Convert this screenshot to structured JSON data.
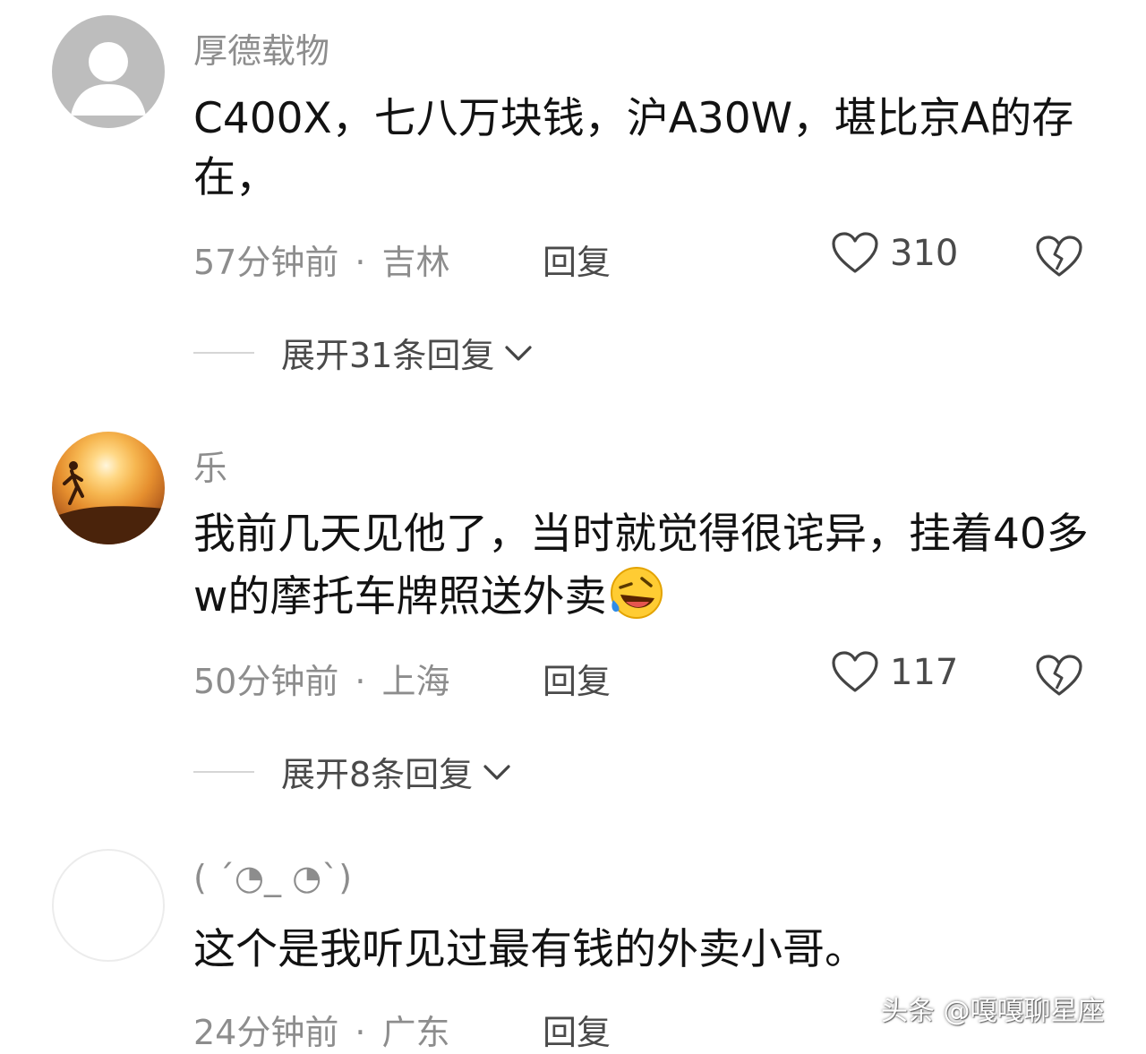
{
  "comments": [
    {
      "username": "厚德载物",
      "content": "C400X，七八万块钱，沪A30W，堪比京A的存在，",
      "time": "57分钟前",
      "location": "吉林",
      "reply_label": "回复",
      "likes": "310",
      "expand_label": "展开31条回复",
      "avatar": "default-avatar"
    },
    {
      "username": "乐",
      "content": "我前几天见他了，当时就觉得很诧异，挂着40多w的摩托车牌照送外卖",
      "emoji": "rofl-emoji",
      "time": "50分钟前",
      "location": "上海",
      "reply_label": "回复",
      "likes": "117",
      "expand_label": "展开8条回复",
      "avatar": "sunset-runner-avatar"
    },
    {
      "username": "( ´◔_ ◔`)",
      "content": "这个是我听见过最有钱的外卖小哥。",
      "time": "24分钟前",
      "location": "广东",
      "reply_label": "回复",
      "avatar": "blank-avatar"
    }
  ],
  "watermark": "头条 @嘎嘎聊星座",
  "colors": {
    "text_primary": "#121212",
    "text_secondary": "#8d8d8d",
    "divider": "#d6d6d6"
  }
}
